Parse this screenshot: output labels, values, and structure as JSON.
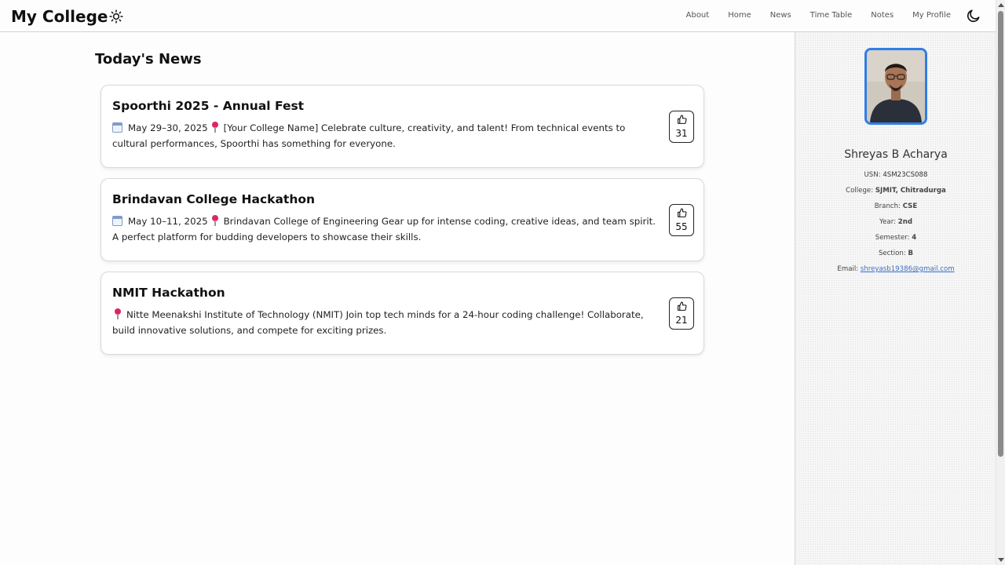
{
  "header": {
    "brand": "My College",
    "nav": [
      "About",
      "Home",
      "News",
      "Time Table",
      "Notes",
      "My Profile"
    ]
  },
  "main": {
    "title": "Today's News",
    "news": [
      {
        "title": "Spoorthi 2025 - Annual Fest",
        "date": "May 29–30, 2025",
        "text": "[Your College Name] Celebrate culture, creativity, and talent! From technical events to cultural performances, Spoorthi has something for everyone.",
        "likes": "31"
      },
      {
        "title": "Brindavan College Hackathon",
        "date": "May 10–11, 2025",
        "text": "Brindavan College of Engineering Gear up for intense coding, creative ideas, and team spirit. A perfect platform for budding developers to showcase their skills.",
        "likes": "55"
      },
      {
        "title": "NMIT Hackathon",
        "date": "",
        "text": "Nitte Meenakshi Institute of Technology (NMIT) Join top tech minds for a 24-hour coding challenge! Collaborate, build innovative solutions, and compete for exciting prizes.",
        "likes": "21"
      }
    ]
  },
  "profile": {
    "name": "Shreyas B Acharya",
    "fields": [
      {
        "label": "USN:",
        "value": "4SM23CS088"
      },
      {
        "label": "College:",
        "value": "SJMIT, Chitradurga"
      },
      {
        "label": "Branch:",
        "value": "CSE"
      },
      {
        "label": "Year:",
        "value": "2nd"
      },
      {
        "label": "Semester:",
        "value": "4"
      },
      {
        "label": "Section:",
        "value": "B"
      }
    ],
    "email_label": "Email:",
    "email": "shreyasb19386@gmail.com"
  },
  "colors": {
    "accent": "#2f7ee6",
    "link": "#3a6fc4"
  }
}
